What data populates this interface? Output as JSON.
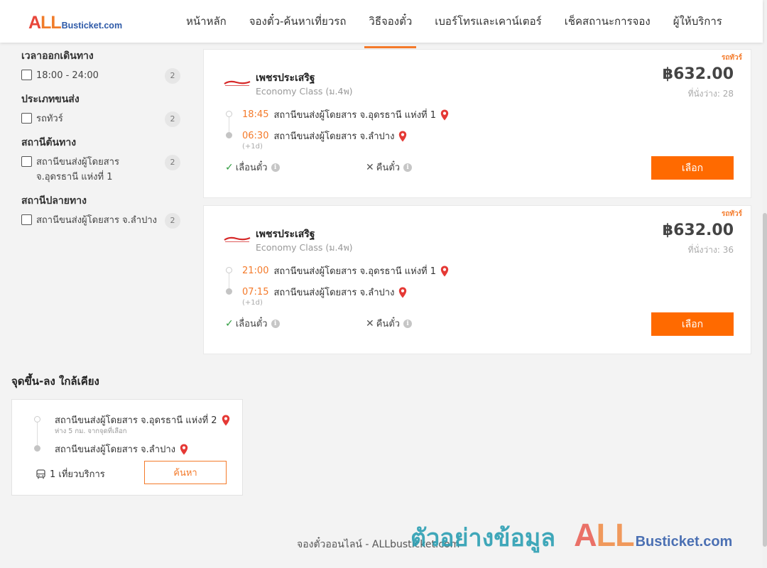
{
  "header": {
    "logo": {
      "all": "ALL",
      "brand": "Busticket.com"
    },
    "nav": [
      {
        "label": "หน้าหลัก"
      },
      {
        "label": "จองตั๋ว-ค้นหาเที่ยวรถ"
      },
      {
        "label": "วิธีจองตั๋ว"
      },
      {
        "label": "เบอร์โทรและเคาน์เตอร์"
      },
      {
        "label": "เช็คสถานะการจอง"
      },
      {
        "label": "ผู้ให้บริการ"
      }
    ],
    "active_nav": "วิธีจองตั๋ว"
  },
  "filters": {
    "departure_time": {
      "title": "เวลาออกเดินทาง",
      "options": [
        {
          "label": "18:00 - 24:00",
          "count": "2"
        }
      ]
    },
    "bus_type": {
      "title": "ประเภทขนส่ง",
      "options": [
        {
          "label": "รถทัวร์",
          "count": "2"
        }
      ]
    },
    "origin": {
      "title": "สถานีต้นทาง",
      "options": [
        {
          "label_line1": "สถานีขนส่งผู้โดยสาร",
          "label_line2": "จ.อุดรธานี แห่งที่ 1",
          "count": "2"
        }
      ]
    },
    "destination": {
      "title": "สถานีปลายทาง",
      "options": [
        {
          "label": "สถานีขนส่งผู้โดยสาร จ.ลำปาง",
          "count": "2"
        }
      ]
    }
  },
  "trips": [
    {
      "corner_tag": "รถทัวร์",
      "operator": "เพชรประเสริฐ",
      "class": "Economy Class (ม.4พ)",
      "price": "฿632.00",
      "seats": "ที่นั่งว่าง: 28",
      "depart_time": "18:45",
      "depart_place": "สถานีขนส่งผู้โดยสาร จ.อุดรธานี แห่งที่ 1",
      "arrive_time": "06:30",
      "arrive_place": "สถานีขนส่งผู้โดยสาร จ.ลำปาง",
      "next_day": "(+1d)",
      "reschedule": "เลื่อนตั๋ว",
      "refund": "คืนตั๋ว",
      "select": "เลือก"
    },
    {
      "corner_tag": "รถทัวร์",
      "operator": "เพชรประเสริฐ",
      "class": "Economy Class (ม.4พ)",
      "price": "฿632.00",
      "seats": "ที่นั่งว่าง: 36",
      "depart_time": "21:00",
      "depart_place": "สถานีขนส่งผู้โดยสาร จ.อุดรธานี แห่งที่ 1",
      "arrive_time": "07:15",
      "arrive_place": "สถานีขนส่งผู้โดยสาร จ.ลำปาง",
      "next_day": "(+1d)",
      "reschedule": "เลื่อนตั๋ว",
      "refund": "คืนตั๋ว",
      "select": "เลือก"
    }
  ],
  "nearby": {
    "title": "จุดขึ้น-ลง ใกล้เคียง",
    "from": "สถานีขนส่งผู้โดยสาร จ.อุดรธานี แห่งที่ 2",
    "from_note": "ห่าง 5 กม. จากจุดที่เลือก",
    "to": "สถานีขนส่งผู้โดยสาร จ.ลำปาง",
    "trips": "1 เที่ยวบริการ",
    "search": "ค้นหา"
  },
  "footer": {
    "text": "จองตั๋วออนไลน์ - ALLbusticket.com"
  },
  "watermark": {
    "thai": "ตัวอย่างข้อมูล",
    "all": "ALL",
    "brand": "Busticket.com"
  },
  "colors": {
    "accent": "#ff6a00",
    "accent_text": "#f47a2a",
    "brand_red": "#e8463a",
    "brand_blue": "#2e5aa8",
    "watermark_teal": "#2c9fb3"
  }
}
